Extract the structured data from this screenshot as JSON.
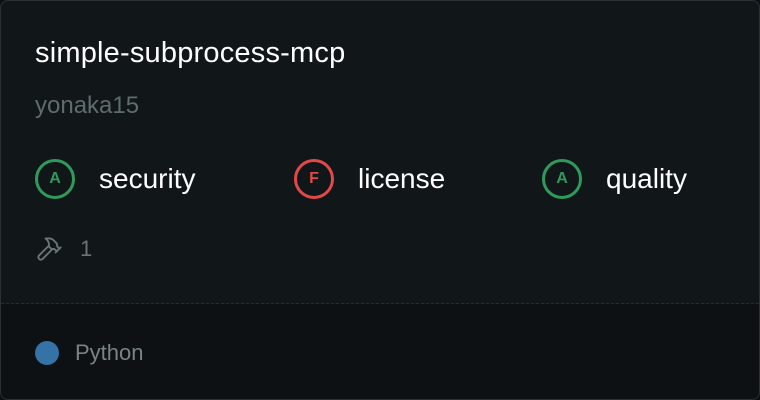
{
  "card": {
    "title": "simple-subprocess-mcp",
    "author": "yonaka15"
  },
  "scores": [
    {
      "grade": "A",
      "label": "security",
      "status": "good",
      "color": "#2f9a5b"
    },
    {
      "grade": "F",
      "label": "license",
      "status": "bad",
      "color": "#e24848"
    },
    {
      "grade": "A",
      "label": "quality",
      "status": "good",
      "color": "#2f9a5b"
    }
  ],
  "tools": {
    "icon": "hammer-icon",
    "count": "1"
  },
  "language": {
    "name": "Python",
    "color": "#3572A5"
  }
}
